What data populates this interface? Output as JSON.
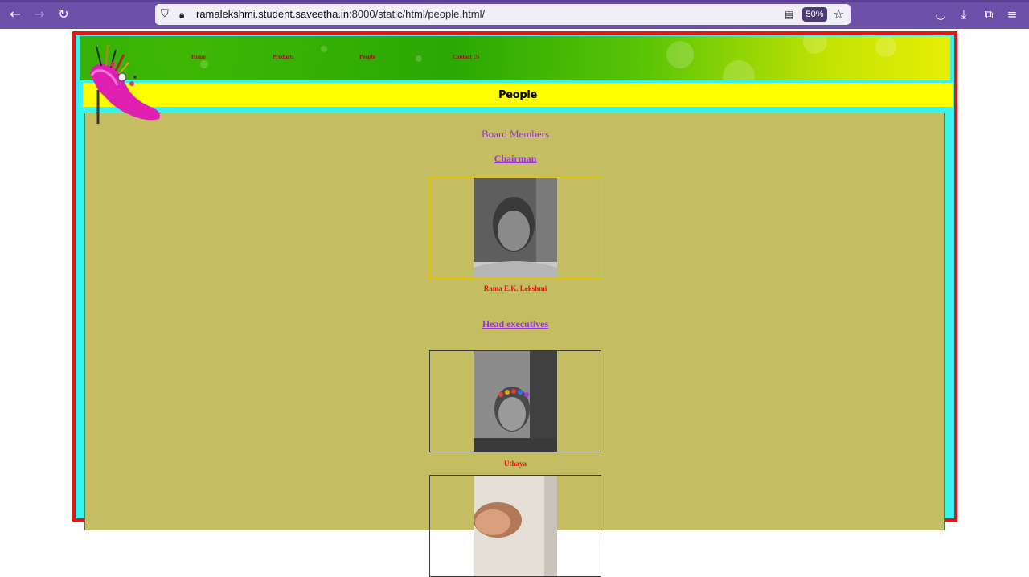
{
  "browser": {
    "url_host": "ramalekshmi.student.saveetha.in",
    "url_rest": ":8000/static/html/people.html/",
    "zoom": "50%",
    "icons": [
      "back-icon",
      "forward-icon",
      "reload-icon",
      "shield-icon",
      "lock-icon",
      "reader-view-icon",
      "bookmark-star-icon",
      "pocket-icon",
      "download-icon",
      "extensions-icon",
      "menu-icon"
    ],
    "accent_color": "#6b4fa9"
  },
  "site": {
    "menu": [
      {
        "label": "Home"
      },
      {
        "label": "Products"
      },
      {
        "label": "People"
      },
      {
        "label": "Contact Us"
      }
    ],
    "page_title": "People",
    "colors": {
      "frame_border": "#ee1111",
      "frame_fill": "#39f2ee",
      "title_bar": "#ffff00",
      "content_bg": "#c4bd62",
      "heading_color": "#9933dd",
      "name_color": "#ee1111"
    }
  },
  "content": {
    "board_heading": "Board Members",
    "chairman_heading": "Chairman",
    "chairman": {
      "name": "Rama E.K. Lekshmi"
    },
    "executives_heading": "Head executives",
    "executives": [
      {
        "name": "Uthaya"
      },
      {
        "name": ""
      }
    ]
  }
}
